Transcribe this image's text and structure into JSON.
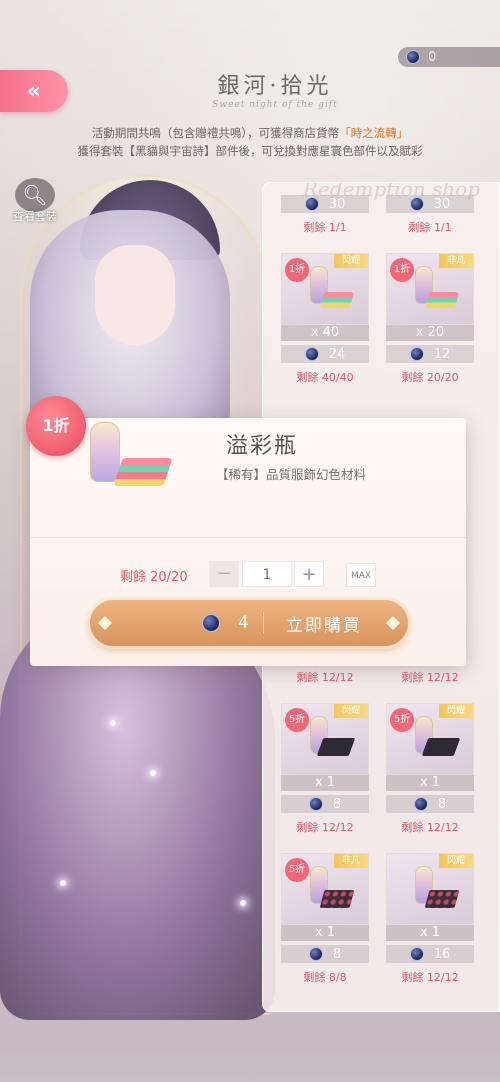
{
  "header": {
    "back_label": "«",
    "currency_amount": "0",
    "event_title": "銀河·拾光",
    "event_subtitle": "Sweet night of the gift"
  },
  "description": {
    "line1_prefix": "活動期間共鳴（包含贈禮共鳴），可獲得商店貨幣",
    "line1_highlight": "「時之流轉」",
    "line2": "獲得套裝【黑貓與宇宙詩】部件後，可兌換對應星寰色部件以及賦彩"
  },
  "view_outfit": {
    "label": "查看套裝"
  },
  "shop": {
    "watermark": "Redemption shop",
    "items": [
      {
        "discount": "",
        "tag": "",
        "qty": "",
        "price": "30",
        "remain": "剩餘 1/1",
        "art": "none"
      },
      {
        "discount": "",
        "tag": "",
        "qty": "",
        "price": "30",
        "remain": "剩餘 1/1",
        "art": "none"
      },
      {
        "discount": "1折",
        "tag": "閃耀",
        "qty": "x 40",
        "price": "24",
        "remain": "剩餘 40/40",
        "art": "cloth"
      },
      {
        "discount": "1折",
        "tag": "非凡",
        "qty": "x 20",
        "price": "12",
        "remain": "剩餘 20/20",
        "art": "cloth"
      },
      {
        "discount": "5折",
        "tag": "閃耀",
        "qty": "x 1",
        "price": "8",
        "remain": "剩餘 12/12",
        "art": "dark"
      },
      {
        "discount": "5折",
        "tag": "閃耀",
        "qty": "x 1",
        "price": "8",
        "remain": "剩餘 12/12",
        "art": "dark"
      },
      {
        "discount": "5折",
        "tag": "非凡",
        "qty": "x 1",
        "price": "8",
        "remain": "剩餘 8/8",
        "art": "gems"
      },
      {
        "discount": "",
        "tag": "閃耀",
        "qty": "x 1",
        "price": "16",
        "remain": "剩餘 12/12",
        "art": "gems"
      }
    ],
    "hidden_row_remains": [
      "剩餘 12/12",
      "剩餘 12/12"
    ]
  },
  "popup": {
    "discount": "1折",
    "name": "溢彩瓶",
    "description": "【稀有】品質服飾幻色材料",
    "remain": "剩餘 20/20",
    "minus": "−",
    "quantity": "1",
    "plus": "+",
    "max_label": "MAX",
    "price": "4",
    "buy_label": "立即購買"
  }
}
